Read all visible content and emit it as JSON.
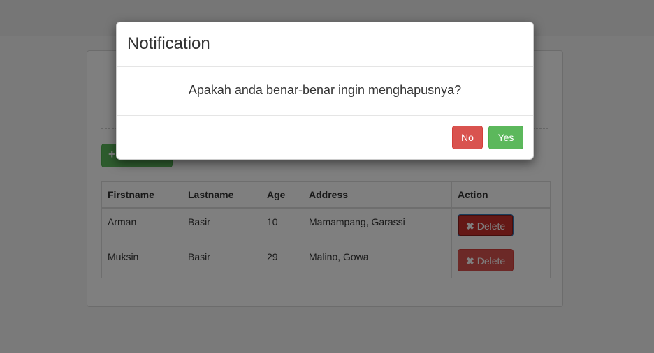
{
  "modal": {
    "title": "Notification",
    "message": "Apakah anda benar-benar ingin menghapusnya?",
    "no_label": "No",
    "yes_label": "Yes"
  },
  "add_button": {
    "icon": "plus-icon"
  },
  "table": {
    "headers": [
      "Firstname",
      "Lastname",
      "Age",
      "Address",
      "Action"
    ],
    "rows": [
      {
        "firstname": "Arman",
        "lastname": "Basir",
        "age": "10",
        "address": "Mamampang, Garassi",
        "action": "Delete"
      },
      {
        "firstname": "Muksin",
        "lastname": "Basir",
        "age": "29",
        "address": "Malino, Gowa",
        "action": "Delete"
      }
    ]
  },
  "colors": {
    "danger": "#d9534f",
    "success": "#5cb85c",
    "backdrop": "rgba(0,0,0,0.5)"
  }
}
